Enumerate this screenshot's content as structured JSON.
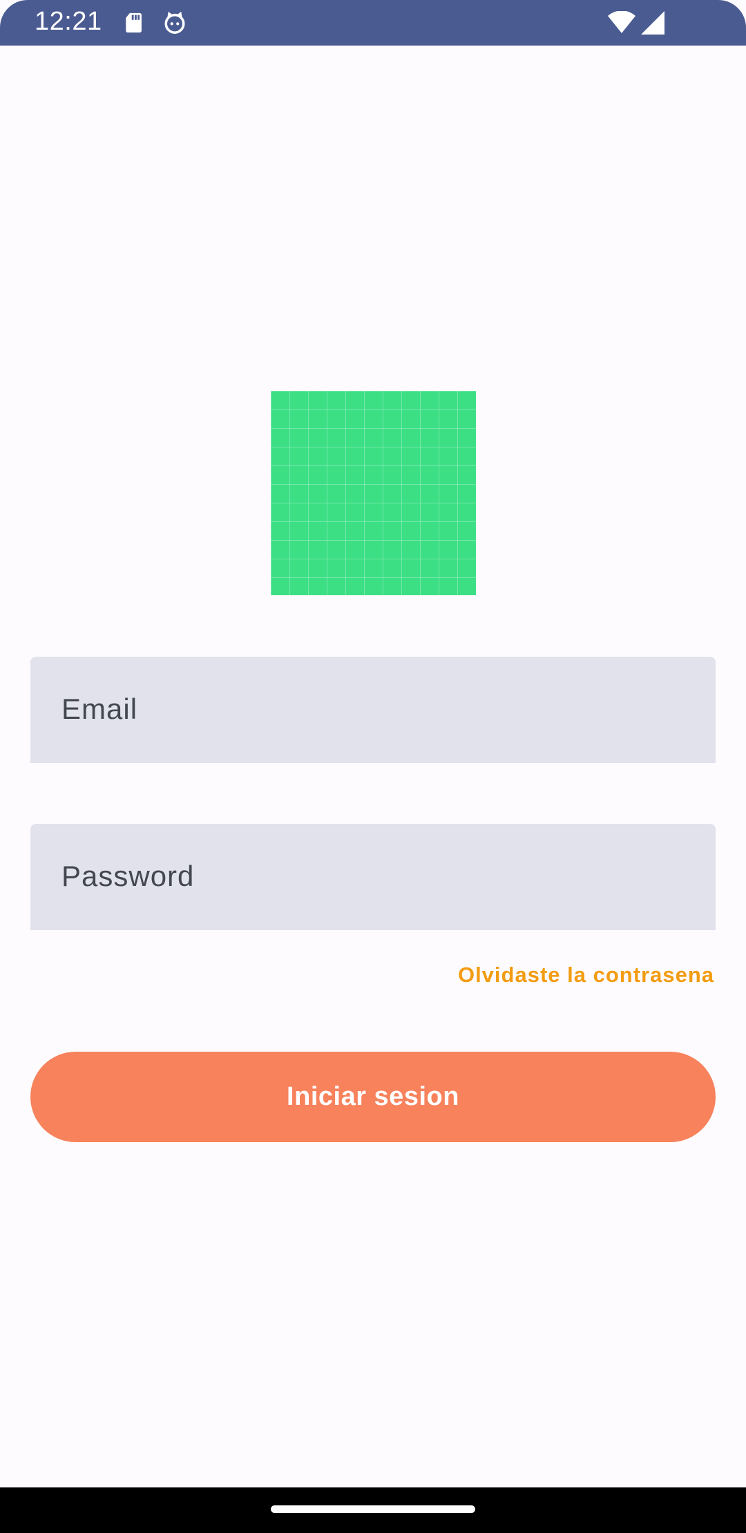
{
  "status_bar": {
    "time": "12:21",
    "icons": [
      "sd-card-icon",
      "cat-face-icon",
      "wifi-icon",
      "signal-icon"
    ]
  },
  "logo": {
    "color": "#3ddf85"
  },
  "form": {
    "email_placeholder": "Email",
    "password_placeholder": "Password",
    "forgot_password_label": "Olvidaste la contrasena",
    "login_button_label": "Iniciar sesion"
  },
  "colors": {
    "status_bar": "#4a5b91",
    "background": "#fdfbfe",
    "field_background": "#e1e2ec",
    "accent_link": "#f39c12",
    "primary_button": "#f7825c"
  }
}
